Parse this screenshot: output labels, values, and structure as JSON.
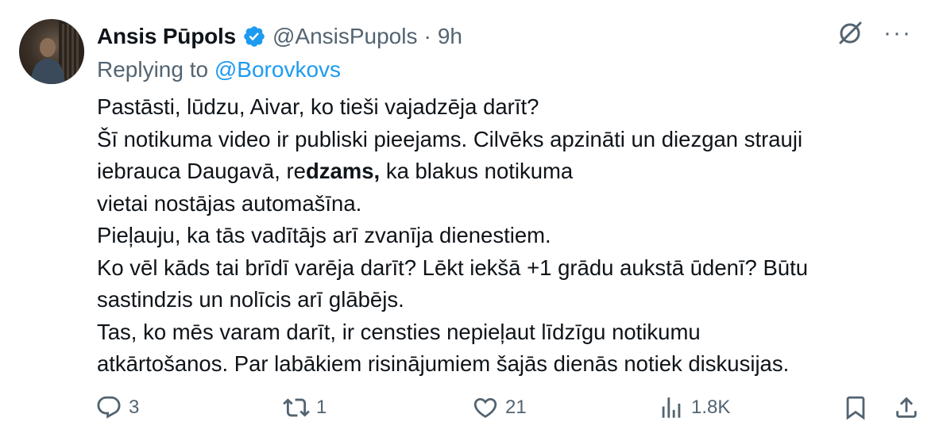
{
  "tweet": {
    "author_name": "Ansis Pūpols",
    "handle": "@AnsisPupols",
    "separator": "·",
    "time": "9h",
    "replying_label": "Replying to",
    "replying_to": "@Borovkovs",
    "more_label": "···",
    "body": {
      "line1": "Pastāsti, lūdzu, Aivar, ko tieši vajadzēja darīt?",
      "line2": "Šī notikuma video ir publiski pieejams. Cilvēks apzināti un diezgan strauji",
      "line3_a": "iebrauca Daugavā, re",
      "line3_bold": "dzams,",
      "line3_b": " ka blakus notikuma",
      "line4": "vietai nostājas automašīna.",
      "line5": "Pieļauju, ka tās vadītājs arī zvanīja dienestiem.",
      "line6": "Ko vēl kāds tai brīdī varēja darīt? Lēkt iekšā +1 grādu aukstā ūdenī? Būtu",
      "line7": "sastindzis un nolīcis arī glābējs.",
      "line8": "Tas, ko mēs varam darīt, ir censties nepieļaut līdzīgu notikumu",
      "line9": "atkārtošanos. Par labākiem risinājumiem šajās dienās notiek diskusijas."
    }
  },
  "actions": {
    "replies": "3",
    "retweets": "1",
    "likes": "21",
    "views": "1.8K"
  },
  "icons": {
    "verified": "verified-badge-icon",
    "grok": "grok-icon",
    "more": "more-icon",
    "reply": "reply-icon",
    "retweet": "retweet-icon",
    "like": "heart-icon",
    "views": "views-icon",
    "bookmark": "bookmark-icon",
    "share": "share-icon"
  },
  "colors": {
    "accent": "#1d9bf0",
    "muted": "#536471",
    "text": "#0f1419"
  }
}
